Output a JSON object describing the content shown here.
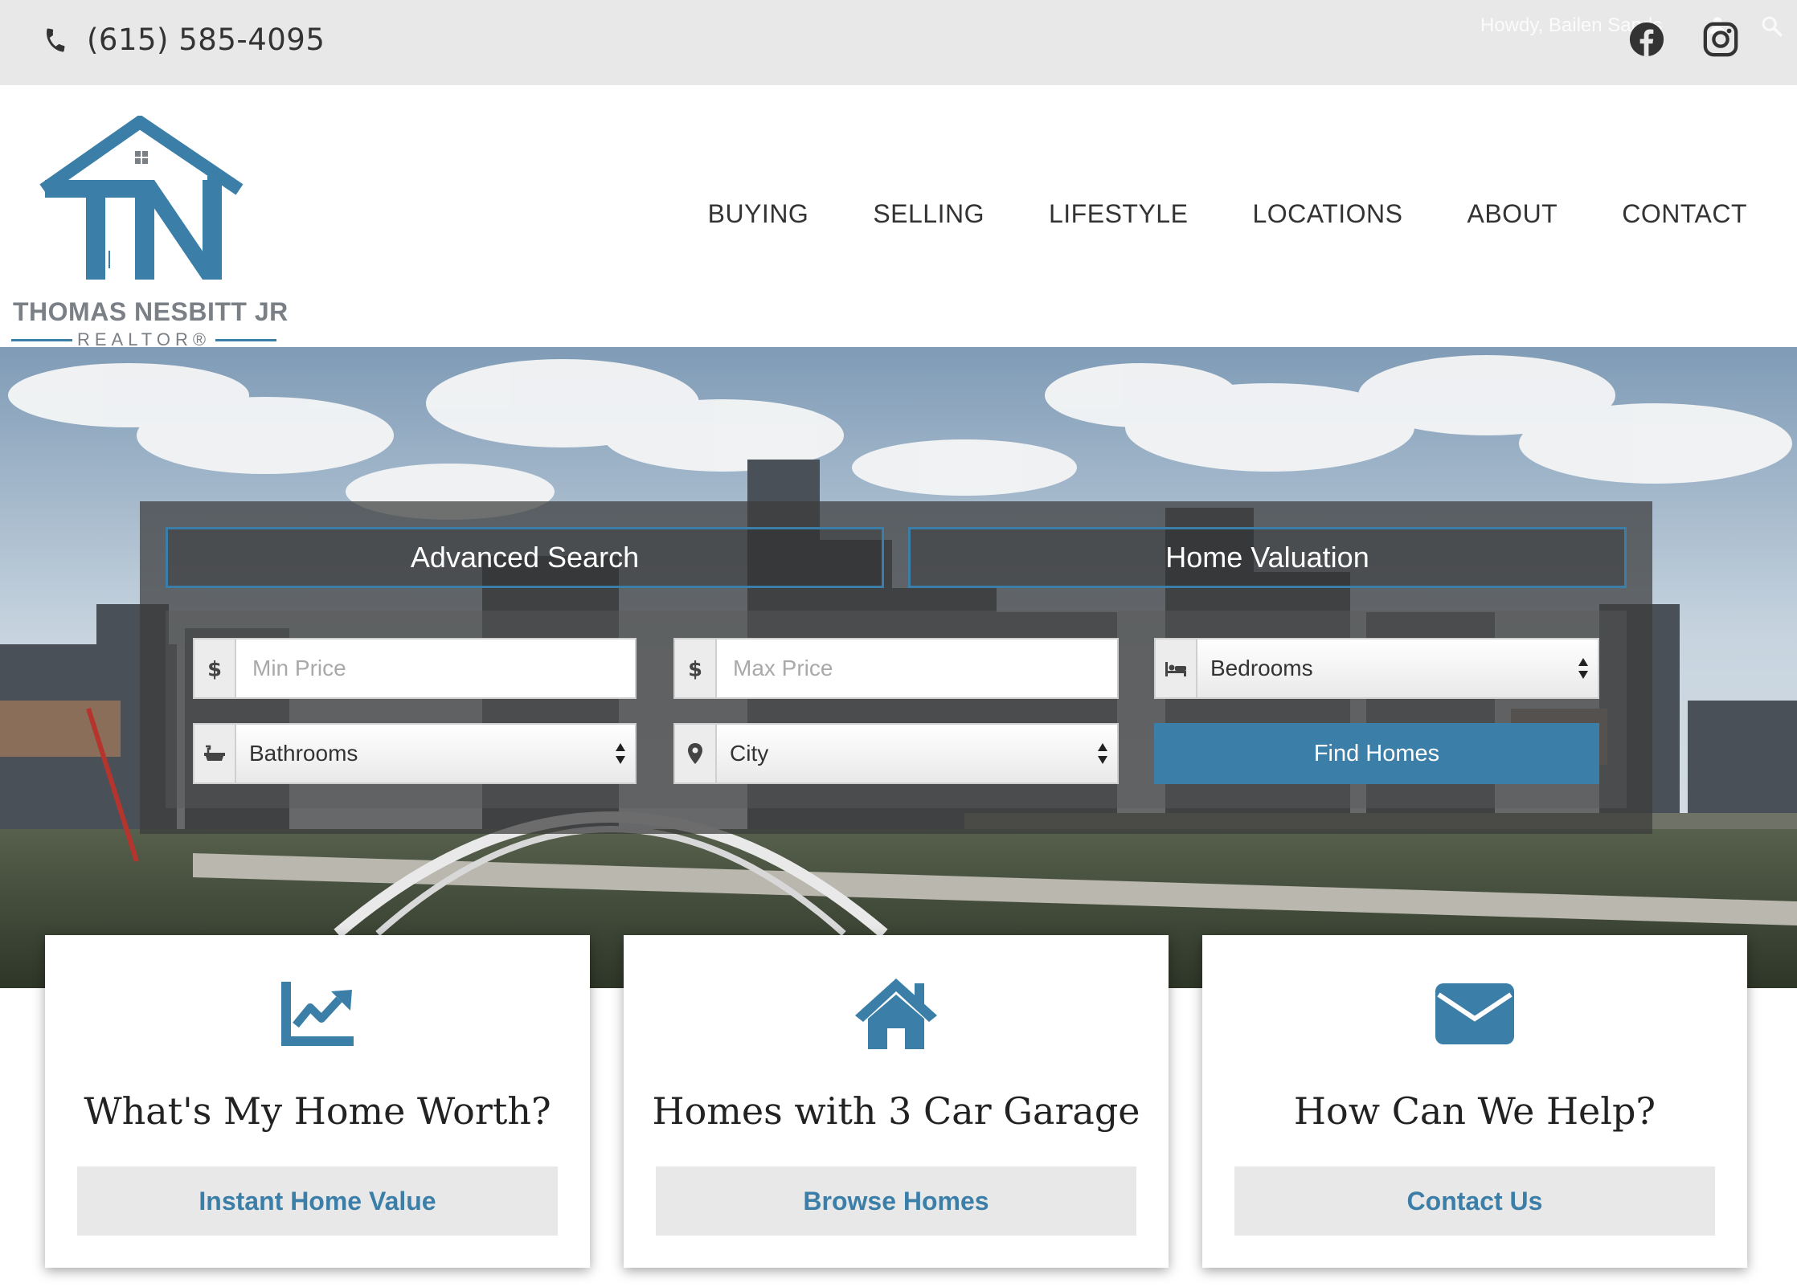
{
  "topbar": {
    "phone": "(615) 585-4095",
    "howdy": "Howdy, Bailen Sands",
    "social": [
      "facebook-icon",
      "instagram-icon"
    ]
  },
  "logo": {
    "initials": "TN",
    "name": "THOMAS NESBITT JR",
    "subtitle": "REALTOR®"
  },
  "nav": {
    "items": [
      "BUYING",
      "SELLING",
      "LIFESTYLE",
      "LOCATIONS",
      "ABOUT",
      "CONTACT"
    ]
  },
  "search": {
    "tabs": [
      "Advanced Search",
      "Home Valuation"
    ],
    "min_price_placeholder": "Min Price",
    "max_price_placeholder": "Max Price",
    "bedrooms": "Bedrooms",
    "bathrooms": "Bathrooms",
    "city": "City",
    "find_label": "Find Homes"
  },
  "cards": [
    {
      "icon": "chart-line-icon",
      "title": "What's My Home Worth?",
      "button": "Instant Home Value"
    },
    {
      "icon": "home-icon",
      "title": "Homes with 3 Car Garage",
      "button": "Browse Homes"
    },
    {
      "icon": "envelope-icon",
      "title": "How Can We Help?",
      "button": "Contact Us"
    }
  ],
  "colors": {
    "accent": "#3b7ea8",
    "topbar": "#e8e8e8",
    "text": "#333333"
  }
}
